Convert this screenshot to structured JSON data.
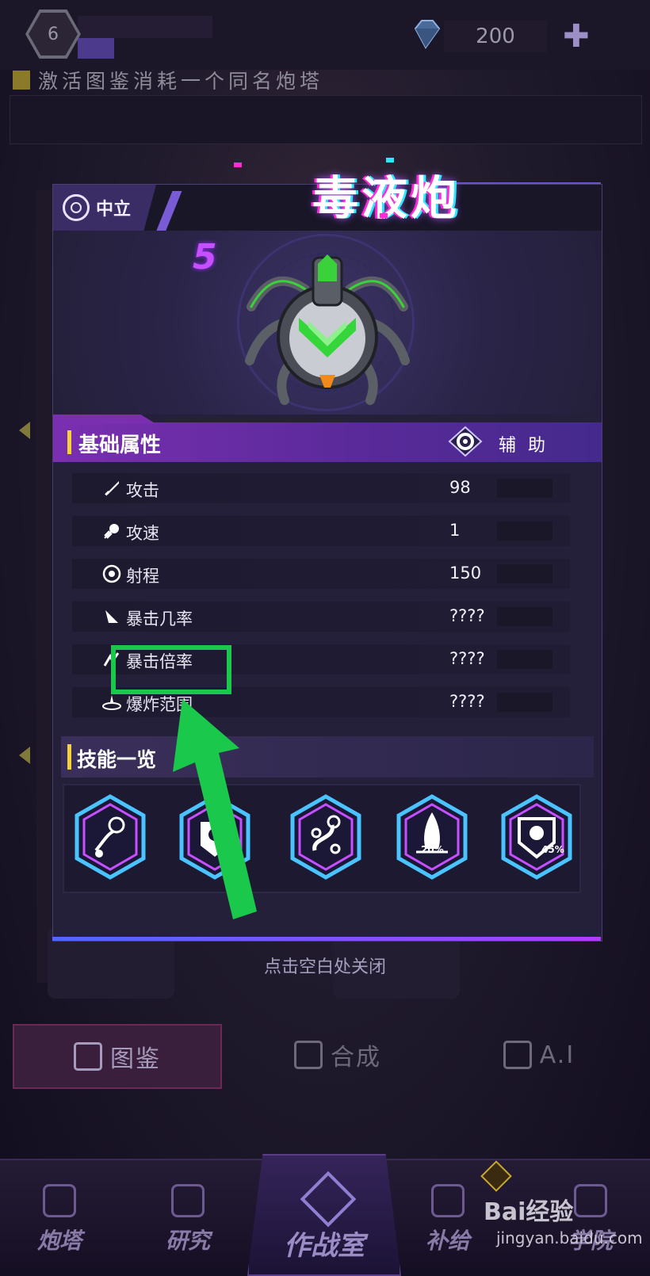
{
  "header": {
    "player_level": "6",
    "gem_count": "200",
    "tip_text": "激活图鉴消耗一个同名炮塔"
  },
  "modal": {
    "faction_label": "中立",
    "title": "毒液炮",
    "tier": "5",
    "base_section_label": "基础属性",
    "role_label": "辅 助",
    "stats": [
      {
        "label": "攻击",
        "value": "98",
        "icon": "sword-icon"
      },
      {
        "label": "攻速",
        "value": "1",
        "icon": "speed-icon"
      },
      {
        "label": "射程",
        "value": "150",
        "icon": "target-icon"
      },
      {
        "label": "暴击几率",
        "value": "????",
        "icon": "crit-chance-icon"
      },
      {
        "label": "暴击倍率",
        "value": "????",
        "icon": "crit-multiplier-icon"
      },
      {
        "label": "爆炸范围",
        "value": "????",
        "icon": "explosion-icon"
      }
    ],
    "skills_section_label": "技能一览",
    "skills": [
      {
        "name": "skill-icon-1",
        "badge": ""
      },
      {
        "name": "skill-icon-2",
        "badge": ""
      },
      {
        "name": "skill-icon-3",
        "badge": ""
      },
      {
        "name": "skill-icon-4",
        "badge": "20%"
      },
      {
        "name": "skill-icon-5",
        "badge": "45%"
      }
    ],
    "close_hint": "点击空白处关闭"
  },
  "tabs": [
    {
      "label": "图鉴",
      "active": true
    },
    {
      "label": "合成",
      "active": false
    },
    {
      "label": "A.I",
      "active": false
    }
  ],
  "bottom_nav": [
    {
      "label": "炮塔"
    },
    {
      "label": "研究"
    },
    {
      "label": "作战室"
    },
    {
      "label": "补给"
    },
    {
      "label": "学院"
    }
  ],
  "watermark": {
    "brand": "Bai经验",
    "url": "jingyan.baidu.com"
  },
  "colors": {
    "highlight": "#1ac84c",
    "accent_purple": "#7a2fb0",
    "title_glow": "#ff2bd6",
    "tier_color": "#c64fff"
  }
}
